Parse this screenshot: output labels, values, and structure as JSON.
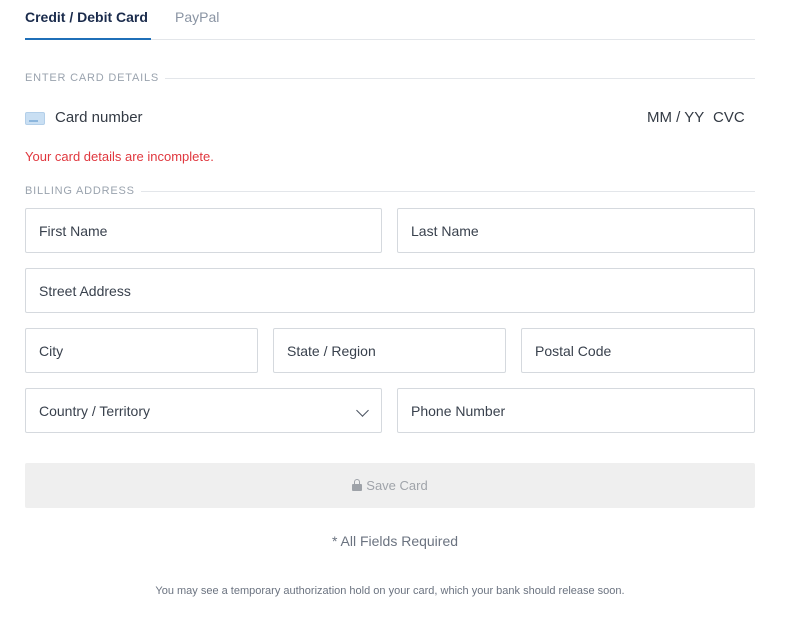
{
  "tabs": [
    {
      "label": "Credit / Debit Card",
      "active": true
    },
    {
      "label": "PayPal",
      "active": false
    }
  ],
  "card_section": {
    "heading": "ENTER CARD DETAILS",
    "card_number_placeholder": "Card number",
    "expiry_placeholder": "MM / YY",
    "cvc_placeholder": "CVC",
    "error": "Your card details are incomplete."
  },
  "billing": {
    "heading": "BILLING ADDRESS",
    "first_name": "First Name",
    "last_name": "Last Name",
    "street": "Street Address",
    "city": "City",
    "state": "State / Region",
    "postal": "Postal Code",
    "country": "Country / Territory",
    "phone": "Phone Number"
  },
  "save_button": "Save Card",
  "required_note": "* All Fields Required",
  "hold_note": "You may see a temporary authorization hold on your card, which your bank should release soon.",
  "colors": {
    "accent": "#1f6fb8",
    "error": "#e0373e",
    "button_bg": "#efefef"
  }
}
